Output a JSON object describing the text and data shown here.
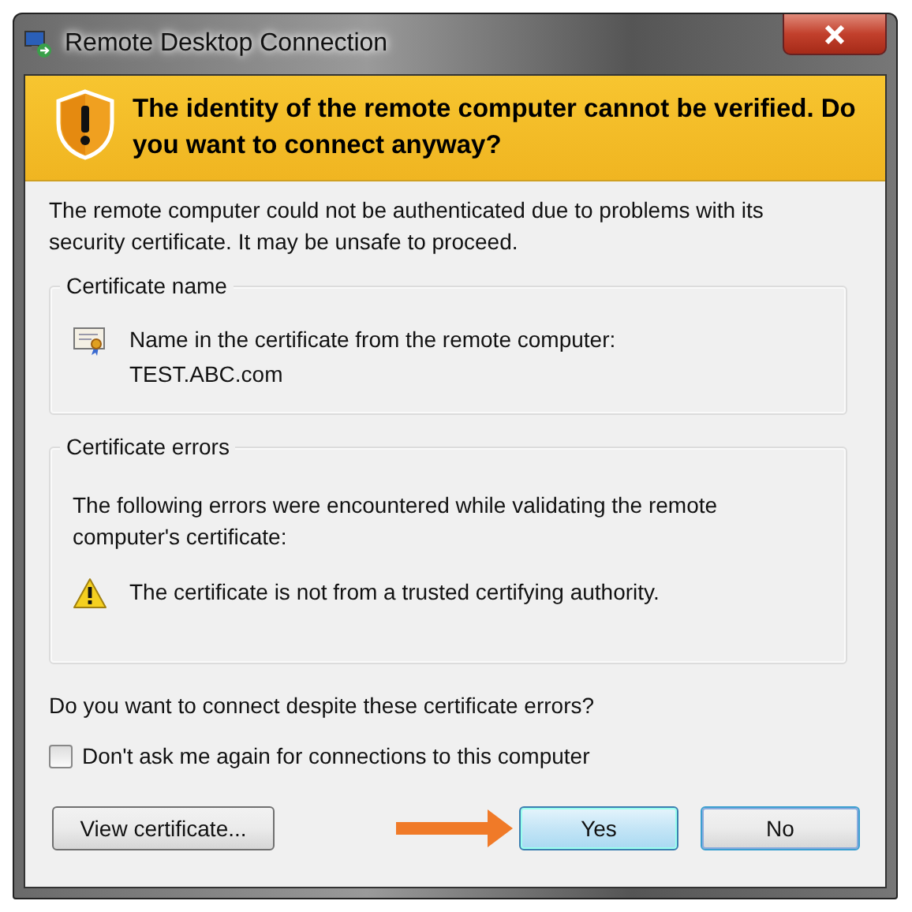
{
  "window": {
    "title": "Remote Desktop Connection"
  },
  "banner": {
    "text": "The identity of the remote computer cannot be verified. Do you want to connect anyway?"
  },
  "message": "The remote computer could not be authenticated due to problems with its security certificate. It may be unsafe to proceed.",
  "certificate_name": {
    "title": "Certificate name",
    "label": "Name in the certificate from the remote computer:",
    "value": "TEST.ABC.com"
  },
  "certificate_errors": {
    "title": "Certificate errors",
    "intro": "The following errors were encountered while validating the remote computer's certificate:",
    "errors": [
      "The certificate is not from a trusted certifying authority."
    ]
  },
  "question": "Do you want to connect despite these certificate errors?",
  "checkbox": {
    "label": "Don't ask me again for connections to this computer",
    "checked": false
  },
  "buttons": [
    {
      "label": "View certificate...",
      "focused": false
    },
    {
      "label": "Yes",
      "focused": true
    },
    {
      "label": "No",
      "focused": false
    }
  ]
}
